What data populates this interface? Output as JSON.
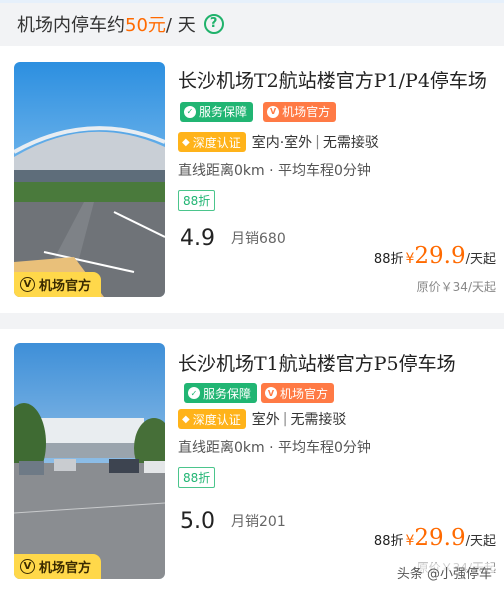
{
  "banner": {
    "prefix": "机场内停车约",
    "price": "50元",
    "suffix": " / 天",
    "help": "?"
  },
  "thumb_tag": {
    "icon_letter": "V",
    "label": "机场官方"
  },
  "cards": [
    {
      "title": "长沙机场T2航站楼官方P1/P4停车场",
      "badge_service": "服务保障",
      "badge_official": "机场官方",
      "badge_verified": "深度认证",
      "tags": [
        "室内·室外",
        "无需接驳"
      ],
      "distance": "直线距离0km · 平均车程0分钟",
      "discount": "88折",
      "rating": "4.9",
      "sales": "月销680",
      "price_discount": "88折",
      "price_yen": "¥",
      "price_value": "29.9",
      "price_unit": "/天起",
      "original_price": "原价￥34/天起"
    },
    {
      "title": "长沙机场T1航站楼官方P5停车场",
      "badge_service": "服务保障",
      "badge_official": "机场官方",
      "badge_verified": "深度认证",
      "tags": [
        "室外",
        "无需接驳"
      ],
      "distance": "直线距离0km · 平均车程0分钟",
      "discount": "88折",
      "rating": "5.0",
      "sales": "月销201",
      "price_discount": "88折",
      "price_yen": "¥",
      "price_value": "29.9",
      "price_unit": "/天起",
      "original_price": "原价￥34/天起"
    }
  ],
  "watermark": "头条 @小强停车",
  "colors": {
    "accent_orange": "#ff6a00",
    "green": "#21b573",
    "yellow": "#ffd84a"
  }
}
